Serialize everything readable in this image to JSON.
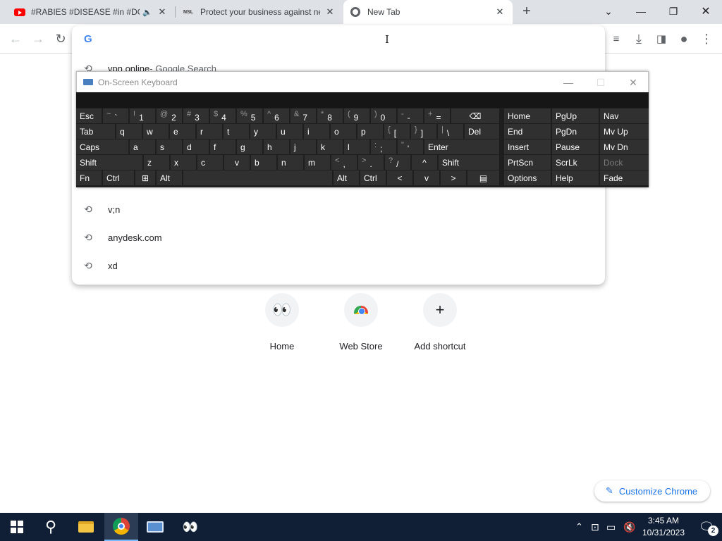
{
  "browser": {
    "tabs": [
      {
        "title": "#RABIES #DISEASE #in #DO",
        "icon": "youtube-icon",
        "audio": true
      },
      {
        "title": "Protect your business against ne",
        "icon": "nsl-icon"
      },
      {
        "title": "New Tab",
        "icon": "chrome-icon",
        "active": true
      }
    ],
    "new_tab": "+"
  },
  "omnibox": {
    "suggestions": [
      {
        "text": "vpn online",
        "sub": " - Google Search"
      },
      {
        "text": "v;n"
      },
      {
        "text": "anydesk.com"
      },
      {
        "text": "xd"
      }
    ]
  },
  "shortcuts": [
    {
      "label": "Home"
    },
    {
      "label": "Web Store"
    },
    {
      "label": "Add shortcut"
    }
  ],
  "customize": {
    "label": "Customize Chrome"
  },
  "osk": {
    "title": "On-Screen Keyboard",
    "rows": [
      [
        {
          "t": "Esc"
        },
        {
          "s": "~",
          "m": "`"
        },
        {
          "s": "!",
          "m": "1"
        },
        {
          "s": "@",
          "m": "2"
        },
        {
          "s": "#",
          "m": "3"
        },
        {
          "s": "$",
          "m": "4"
        },
        {
          "s": "%",
          "m": "5"
        },
        {
          "s": "^",
          "m": "6"
        },
        {
          "s": "&",
          "m": "7"
        },
        {
          "s": "*",
          "m": "8"
        },
        {
          "s": "(",
          "m": "9"
        },
        {
          "s": ")",
          "m": "0"
        },
        {
          "s": "-",
          "m": "-"
        },
        {
          "s": "+",
          "m": "="
        },
        {
          "t": "⌫"
        }
      ],
      [
        {
          "t": "Tab"
        },
        {
          "t": "q"
        },
        {
          "t": "w"
        },
        {
          "t": "e"
        },
        {
          "t": "r"
        },
        {
          "t": "t"
        },
        {
          "t": "y"
        },
        {
          "t": "u"
        },
        {
          "t": "i"
        },
        {
          "t": "o"
        },
        {
          "t": "p"
        },
        {
          "s": "{",
          "m": "["
        },
        {
          "s": "}",
          "m": "]"
        },
        {
          "s": "|",
          "m": "\\"
        },
        {
          "t": "Del"
        }
      ],
      [
        {
          "t": "Caps"
        },
        {
          "t": "a"
        },
        {
          "t": "s"
        },
        {
          "t": "d"
        },
        {
          "t": "f"
        },
        {
          "t": "g"
        },
        {
          "t": "h"
        },
        {
          "t": "j"
        },
        {
          "t": "k"
        },
        {
          "t": "l"
        },
        {
          "s": ":",
          "m": ";"
        },
        {
          "s": "\"",
          "m": "'"
        },
        {
          "t": "Enter"
        }
      ],
      [
        {
          "t": "Shift"
        },
        {
          "t": "z"
        },
        {
          "t": "x"
        },
        {
          "t": "c"
        },
        {
          "t": "v"
        },
        {
          "t": "b"
        },
        {
          "t": "n"
        },
        {
          "t": "m"
        },
        {
          "s": "<",
          "m": ","
        },
        {
          "s": ">",
          "m": "."
        },
        {
          "s": "?",
          "m": "/"
        },
        {
          "t": "^"
        },
        {
          "t": "Shift"
        }
      ],
      [
        {
          "t": "Fn"
        },
        {
          "t": "Ctrl"
        },
        {
          "t": "⊞"
        },
        {
          "t": "Alt"
        },
        {
          "t": ""
        },
        {
          "t": "Alt"
        },
        {
          "t": "Ctrl"
        },
        {
          "t": "<"
        },
        {
          "t": "v"
        },
        {
          "t": ">"
        },
        {
          "t": "▤"
        }
      ]
    ],
    "nav": [
      [
        "Home",
        "PgUp",
        "Nav"
      ],
      [
        "End",
        "PgDn",
        "Mv Up"
      ],
      [
        "Insert",
        "Pause",
        "Mv Dn"
      ],
      [
        "PrtScn",
        "ScrLk",
        "Dock"
      ],
      [
        "Options",
        "Help",
        "Fade"
      ]
    ]
  },
  "taskbar": {
    "time": "3:45 AM",
    "date": "10/31/2023",
    "notifications": "2"
  }
}
